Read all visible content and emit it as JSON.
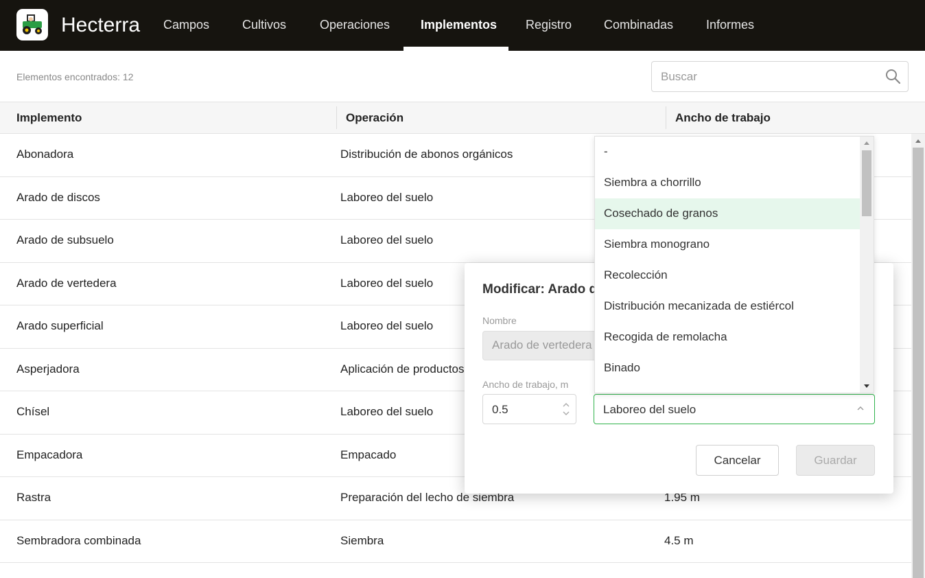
{
  "app": {
    "name": "Hecterra",
    "logo_icon": "tractor-icon",
    "accent": "#2fb24a"
  },
  "nav": {
    "items": [
      {
        "label": "Campos",
        "active": false
      },
      {
        "label": "Cultivos",
        "active": false
      },
      {
        "label": "Operaciones",
        "active": false
      },
      {
        "label": "Implementos",
        "active": true
      },
      {
        "label": "Registro",
        "active": false
      },
      {
        "label": "Combinadas",
        "active": false
      },
      {
        "label": "Informes",
        "active": false
      }
    ]
  },
  "toolbar": {
    "count_text": "Elementos encontrados: 12",
    "search_placeholder": "Buscar",
    "search_icon": "search-icon"
  },
  "table": {
    "headers": [
      "Implemento",
      "Operación",
      "Ancho de trabajo"
    ],
    "rows": [
      [
        "Abonadora",
        "Distribución de abonos orgánicos",
        ""
      ],
      [
        "Arado de discos",
        "Laboreo del suelo",
        ""
      ],
      [
        "Arado de subsuelo",
        "Laboreo del suelo",
        ""
      ],
      [
        "Arado de vertedera",
        "Laboreo del suelo",
        ""
      ],
      [
        "Arado superficial",
        "Laboreo del suelo",
        ""
      ],
      [
        "Asperjadora",
        "Aplicación de productos",
        ""
      ],
      [
        "Chísel",
        "Laboreo del suelo",
        ""
      ],
      [
        "Empacadora",
        "Empacado",
        ""
      ],
      [
        "Rastra",
        "Preparación del lecho de siembra",
        "1.95 m"
      ],
      [
        "Sembradora combinada",
        "Siembra",
        "4.5 m"
      ]
    ]
  },
  "modal": {
    "title": "Modificar: Arado d",
    "name_label": "Nombre",
    "name_value": "Arado de vertedera",
    "width_label": "Ancho de trabajo, m",
    "width_value": "0.5",
    "operation_value": "Laboreo del suelo",
    "cancel_label": "Cancelar",
    "save_label": "Guardar"
  },
  "dropdown": {
    "options": [
      "-",
      "Siembra a chorrillo",
      "Cosechado de granos",
      "Siembra monograno",
      "Recolección",
      "Distribución mecanizada de estiércol",
      "Recogida de remolacha",
      "Binado"
    ],
    "highlighted": "Cosechado de granos",
    "highlight_color": "#e6f7ec"
  }
}
